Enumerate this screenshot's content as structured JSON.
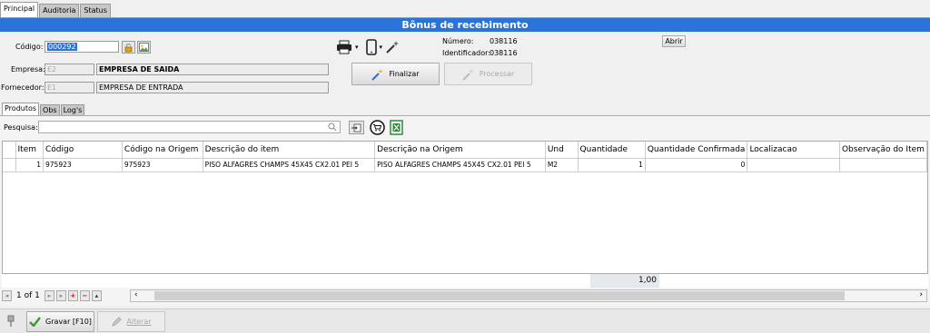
{
  "tabs": [
    "Principal",
    "Auditoria",
    "Status"
  ],
  "title": "Bônus de recebimento",
  "form": {
    "codigo_label": "Código:",
    "codigo_value": "000292",
    "empresa_label": "Empresa:",
    "empresa_code": "E2",
    "empresa_name": "EMPRESA DE SAIDA",
    "fornecedor_label": "Fornecedor:",
    "fornecedor_code": "E1",
    "fornecedor_name": "EMPRESA DE ENTRADA",
    "numero_label": "Número:",
    "numero_value": "038116",
    "identificador_label": "Identificador:",
    "identificador_value": "038116"
  },
  "actions": {
    "abrir": "Abrir",
    "finalizar": "Finalizar",
    "processar": "Processar"
  },
  "inner_tabs": [
    "Produtos",
    "Obs",
    "Log's"
  ],
  "search": {
    "label": "Pesquisa:",
    "value": ""
  },
  "table": {
    "headers": [
      "Item",
      "Código",
      "Código na Origem",
      "Descrição do item",
      "Descrição na Origem",
      "Und",
      "Quantidade",
      "Quantidade Confirmada",
      "Localizacao",
      "Observação do Item"
    ],
    "rows": [
      [
        "1",
        "975923",
        "975923",
        "PISO ALFAGRES CHAMPS 45X45 CX2.01 PEI 5",
        "PISO ALFAGRES CHAMPS 45X45 CX2.01 PEI 5",
        "M2",
        "1",
        "0",
        "",
        ""
      ]
    ],
    "total_quantidade": "1,00"
  },
  "pager": {
    "label": "1 of 1"
  },
  "bottom": {
    "gravar": "Gravar [F10]",
    "alterar": "Alterar"
  },
  "colors": {
    "title_bar": "#2a74d9",
    "selection": "#2a74d9"
  },
  "icons": [
    "printer-icon",
    "mobile-icon",
    "magic-wand-icon",
    "lock-icon",
    "image-icon",
    "search-icon",
    "export-icon",
    "cart-icon",
    "excel-icon",
    "pin-icon",
    "check-icon",
    "pencil-icon"
  ]
}
